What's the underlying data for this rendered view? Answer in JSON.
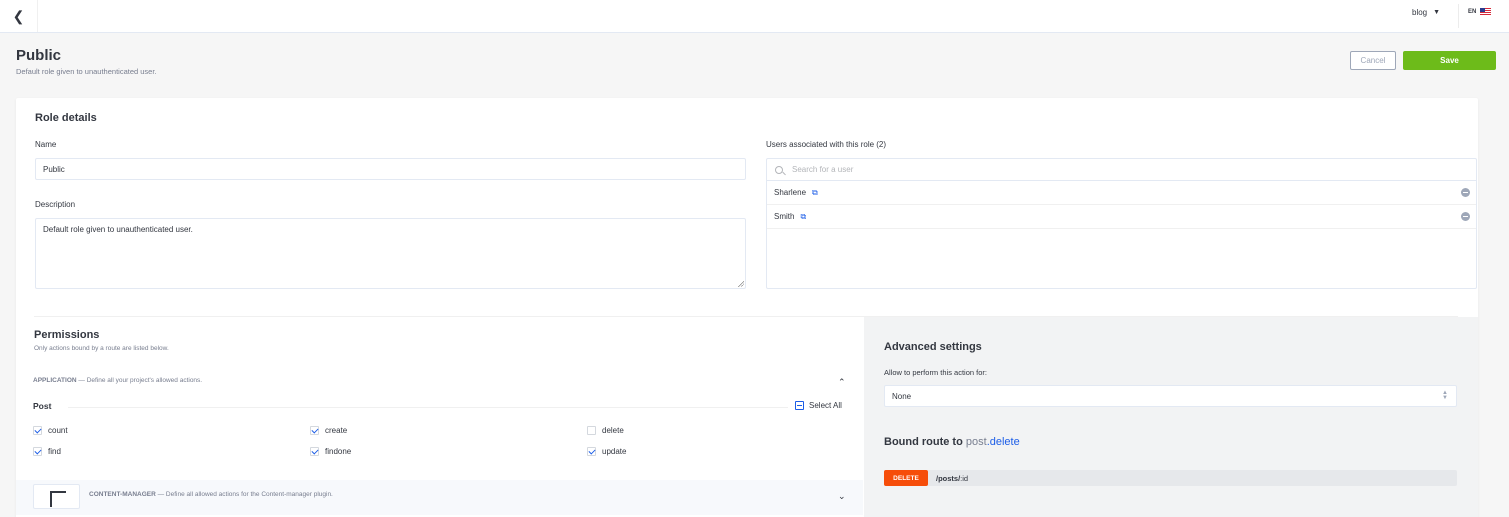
{
  "topbar": {
    "back_icon": "chevron-left-icon",
    "project": "blog",
    "language": "EN"
  },
  "header": {
    "title": "Public",
    "subtitle": "Default role given to unauthenticated user.",
    "cancel_label": "Cancel",
    "save_label": "Save"
  },
  "role_details": {
    "title": "Role details",
    "name_label": "Name",
    "name_value": "Public",
    "description_label": "Description",
    "description_value": "Default role given to unauthenticated user.",
    "users_label": "Users associated with this role (2)",
    "search_placeholder": "Search for a user",
    "users": [
      {
        "name": "Sharlene"
      },
      {
        "name": "Smith"
      }
    ]
  },
  "permissions": {
    "title": "Permissions",
    "subtitle": "Only actions bound by a route are listed below.",
    "application": {
      "name": "APPLICATION",
      "desc": "— Define all your project's allowed actions."
    },
    "group_title": "Post",
    "select_all_label": "Select All",
    "actions": [
      {
        "label": "count",
        "checked": true
      },
      {
        "label": "create",
        "checked": true
      },
      {
        "label": "delete",
        "checked": false
      },
      {
        "label": "find",
        "checked": true
      },
      {
        "label": "findone",
        "checked": true
      },
      {
        "label": "update",
        "checked": true
      }
    ],
    "content_manager": {
      "name": "CONTENT-MANAGER",
      "desc": "— Define all allowed actions for the Content-manager plugin."
    }
  },
  "advanced": {
    "title": "Advanced settings",
    "allow_label": "Allow to perform this action for:",
    "allow_value": "None",
    "bound_prefix": "Bound route to",
    "bound_fn": "post",
    "bound_action": ".delete",
    "route_method": "DELETE",
    "route_path_bold": "/posts/",
    "route_path_rest": ":id"
  },
  "colors": {
    "accent": "#1c5de7",
    "save": "#6dbb1a",
    "delete_method": "#f64d0a"
  }
}
